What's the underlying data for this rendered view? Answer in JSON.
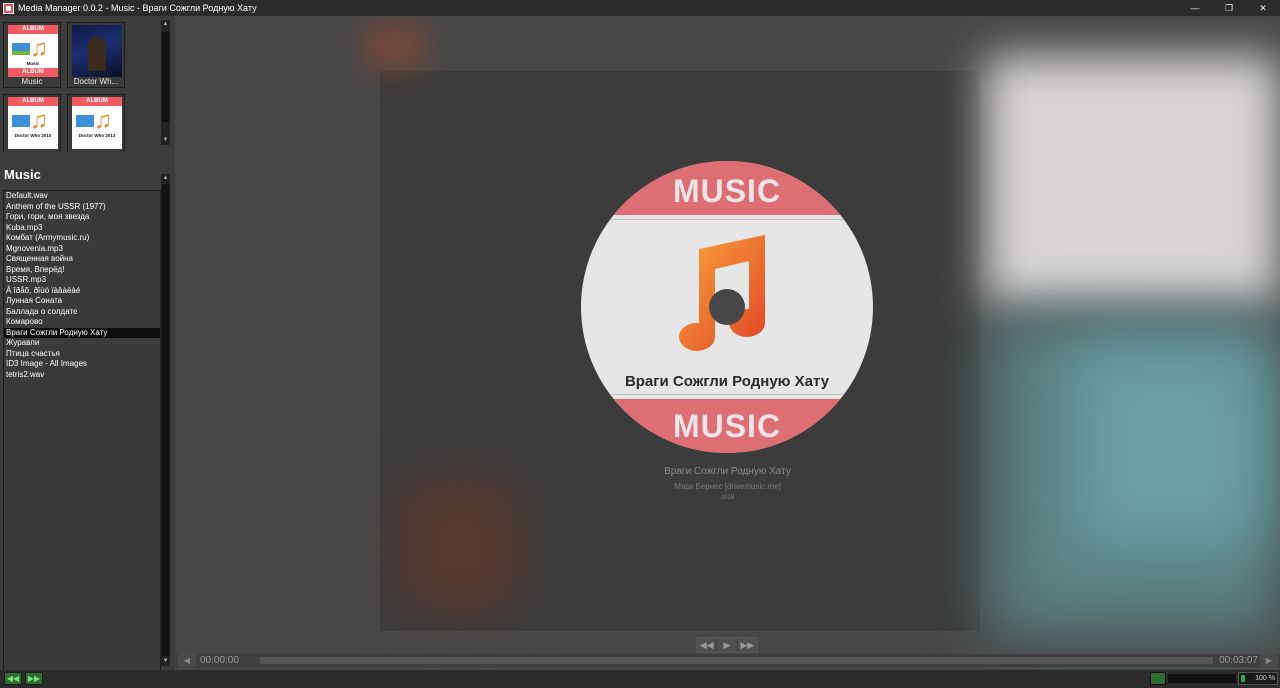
{
  "window": {
    "title": "Media Manager 0.0.2 - Music - Враги Сожгли Родную Хату",
    "minimize": "—",
    "maximize": "❐",
    "close": "✕"
  },
  "albums": [
    {
      "caption": "Music",
      "band": "ALBUM",
      "band_bottom": "ALBUM",
      "label": "Music"
    },
    {
      "caption": "Doctor Wh..."
    },
    {
      "band": "ALBUM",
      "label": "Doctor Who 2010"
    },
    {
      "band": "ALBUM",
      "label": "Doctor Who 2013"
    }
  ],
  "section_title": "Music",
  "tracks": [
    "Default.wav",
    "Anthem of the USSR (1977)",
    "Гори, гори, моя звезда",
    "Kuba.mp3",
    "Комбат (Armymusic.ru)",
    "Mgnovenia.mp3",
    "Священная война",
    "Время, Вперёд!",
    "USSR.mp3",
    "Â îðåõ, ðîùó ïàâàëàé",
    "Лунная Соната",
    "Баллада о солдате",
    "Комарово",
    "Враги Сожгли Родную Хату",
    "Журавли",
    "Птица счастья",
    " ID3 Image - All Images",
    "tetris2.wav"
  ],
  "selected_track_index": 13,
  "now_playing": {
    "disc_top_word": "MUSIC",
    "disc_bottom_word": "MUSIC",
    "disc_title": "Враги Сожгли Родную Хату",
    "title": "Враги Сожгли Родную Хату",
    "artist": "Марк Бернес [drivemusic.me]",
    "year": "2018"
  },
  "transport": {
    "prev": "◀◀",
    "play": "▶",
    "next": "▶▶"
  },
  "seek": {
    "elapsed": "00:00:00",
    "total": "00:03:07",
    "left_arrow": "◀",
    "right_arrow": "▶"
  },
  "volume": {
    "label": "100 %",
    "level": 1.0
  },
  "bottom_buttons": {
    "prev": "◀◀",
    "next": "▶▶"
  },
  "colors": {
    "accent": "#ef5a63",
    "note": "#f08a2a",
    "green": "#2e6e2e"
  }
}
